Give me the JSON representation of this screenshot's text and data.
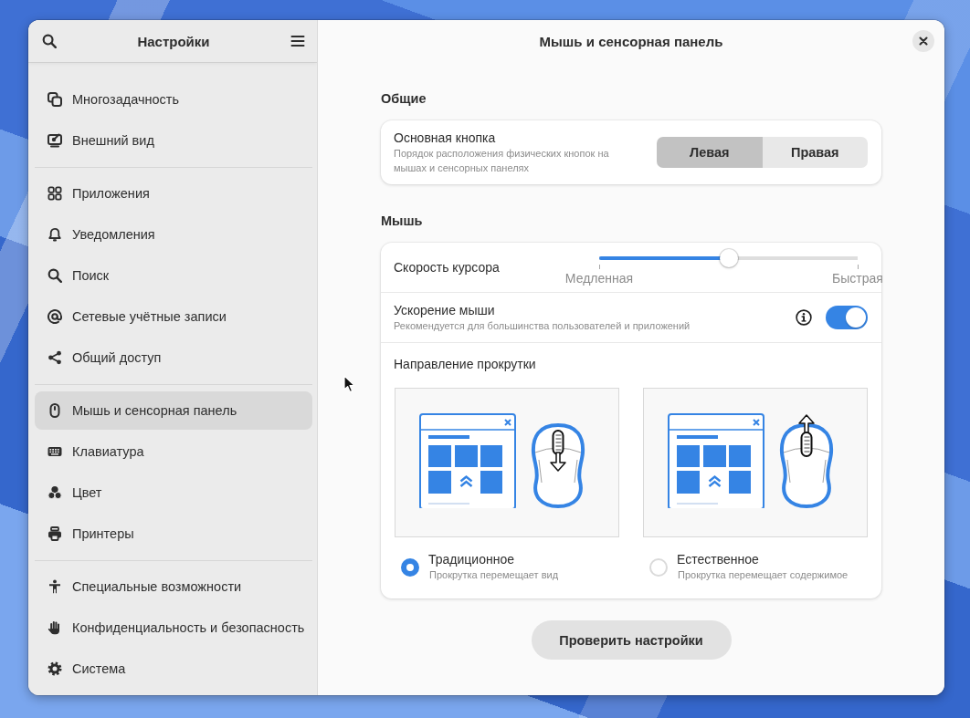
{
  "sidebar": {
    "title": "Настройки",
    "groups": [
      {
        "items": [
          {
            "label": "Многозадачность",
            "selected": false
          },
          {
            "label": "Внешний вид",
            "selected": false
          }
        ]
      },
      {
        "items": [
          {
            "label": "Приложения",
            "selected": false
          },
          {
            "label": "Уведомления",
            "selected": false
          },
          {
            "label": "Поиск",
            "selected": false
          },
          {
            "label": "Сетевые учётные записи",
            "selected": false
          },
          {
            "label": "Общий доступ",
            "selected": false
          }
        ]
      },
      {
        "items": [
          {
            "label": "Мышь и сенсорная панель",
            "selected": true
          },
          {
            "label": "Клавиатура",
            "selected": false
          },
          {
            "label": "Цвет",
            "selected": false
          },
          {
            "label": "Принтеры",
            "selected": false
          }
        ]
      },
      {
        "items": [
          {
            "label": "Специальные возможности",
            "selected": false
          },
          {
            "label": "Конфиденциальность и безопасность",
            "selected": false
          },
          {
            "label": "Система",
            "selected": false
          }
        ]
      }
    ]
  },
  "page": {
    "title": "Мышь и сенсорная панель",
    "general": {
      "heading": "Общие",
      "primary_button": {
        "label": "Основная кнопка",
        "description": "Порядок расположения физических кнопок на мышах и сенсорных панелях",
        "options": [
          {
            "label": "Левая",
            "selected": true
          },
          {
            "label": "Правая",
            "selected": false
          }
        ]
      }
    },
    "mouse": {
      "heading": "Мышь",
      "pointer_speed": {
        "label": "Скорость курсора",
        "level": 0.5,
        "min_label": "Медленная",
        "max_label": "Быстрая"
      },
      "acceleration": {
        "label": "Ускорение мыши",
        "description": "Рекомендуется для большинства пользователей и приложений",
        "on": true
      },
      "scroll_direction": {
        "label": "Направление прокрутки",
        "options": [
          {
            "kind": "traditional",
            "label": "Традиционное",
            "description": "Прокрутка перемещает вид",
            "selected": true
          },
          {
            "kind": "natural",
            "label": "Естественное",
            "description": "Прокрутка перемещает содержимое",
            "selected": false
          }
        ]
      }
    },
    "test_button": "Проверить настройки"
  }
}
